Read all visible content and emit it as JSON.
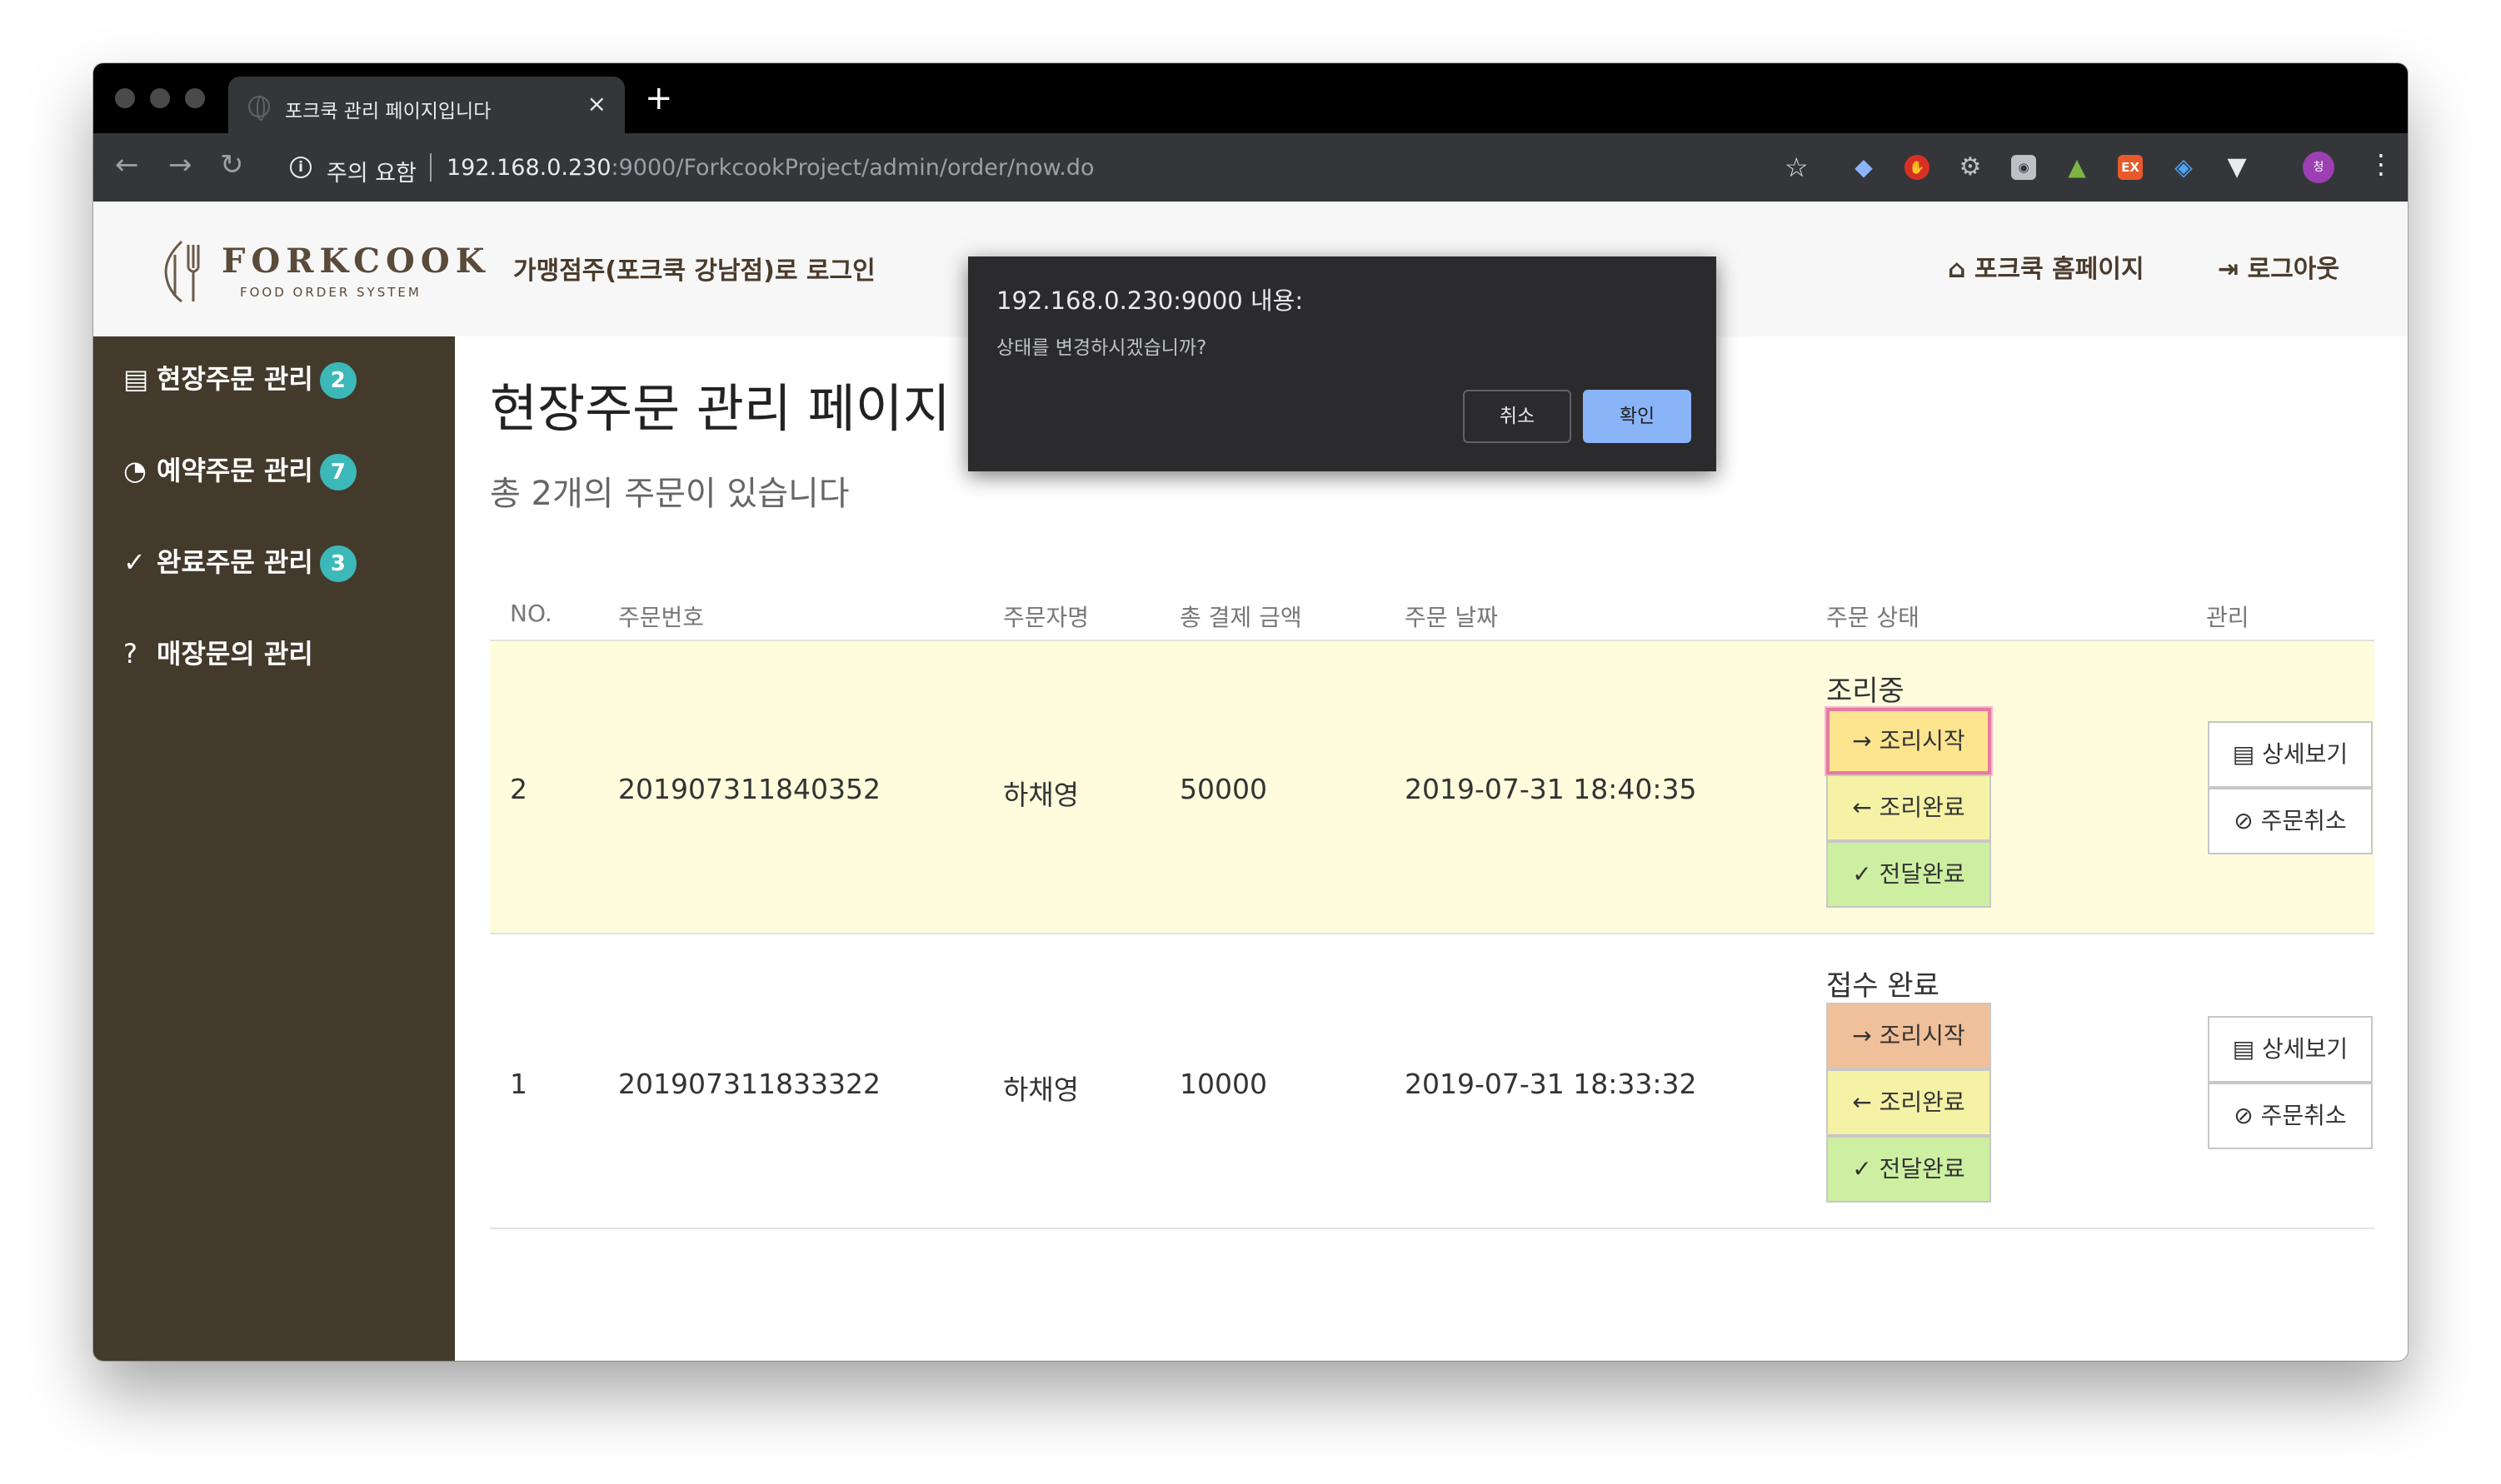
{
  "browser": {
    "tab_title": "포크쿡 관리 페이지입니다",
    "tab_close": "×",
    "new_tab": "+",
    "security_label": "주의 요함",
    "url_host": "192.168.0.230",
    "url_rest": ":9000/ForkcookProject/admin/order/now.do",
    "avatar_initial": "청",
    "ext_ex": "EX",
    "nav_icons": [
      "back-arrow-icon",
      "forward-arrow-icon",
      "reload-icon",
      "info-icon",
      "star-icon",
      "kebab-menu-icon"
    ]
  },
  "header": {
    "logo_text": "FORKCOOK",
    "logo_sub": "FOOD ORDER SYSTEM",
    "login_message": "가맹점주(포크쿡 강남점)로 로그인",
    "home_link": "포크쿡 홈페이지",
    "logout_link": "로그아웃"
  },
  "sidebar": {
    "items": [
      {
        "label": "현장주문 관리",
        "badge": "2",
        "icon": "document-icon"
      },
      {
        "label": "예약주문 관리",
        "badge": "7",
        "icon": "clock-icon"
      },
      {
        "label": "완료주문 관리",
        "badge": "3",
        "icon": "check-icon"
      },
      {
        "label": "매장문의 관리",
        "badge": "",
        "icon": "question-icon"
      }
    ]
  },
  "main": {
    "title": "현장주문 관리 페이지",
    "subtitle": "총 2개의 주문이 있습니다",
    "columns": [
      "NO.",
      "주문번호",
      "주문자명",
      "총 결제 금액",
      "주문 날짜",
      "주문 상태",
      "관리"
    ],
    "rows": [
      {
        "no": "2",
        "order_id": "201907311840352",
        "name": "하채영",
        "amount": "50000",
        "date": "2019-07-31 18:40:35",
        "status": "조리중"
      },
      {
        "no": "1",
        "order_id": "201907311833322",
        "name": "하채영",
        "amount": "10000",
        "date": "2019-07-31 18:33:32",
        "status": "접수 완료"
      }
    ],
    "status_buttons": {
      "start": "조리시작",
      "done": "조리완료",
      "delivered": "전달완료"
    },
    "manage_buttons": {
      "detail": "상세보기",
      "cancel": "주문취소"
    }
  },
  "dialog": {
    "title": "192.168.0.230:9000 내용:",
    "message": "상태를 변경하시겠습니까?",
    "cancel": "취소",
    "ok": "확인"
  },
  "colors": {
    "sidebar_bg": "#433a2c",
    "badge": "#3cb8b8",
    "row_highlight": "#fefcdc",
    "start_yellow": "#fde48f",
    "start_orange": "#f0c09a",
    "done_yellow": "#f5f2a6",
    "delivered_green": "#cdefa2",
    "dialog_ok": "#8ab4f8"
  }
}
